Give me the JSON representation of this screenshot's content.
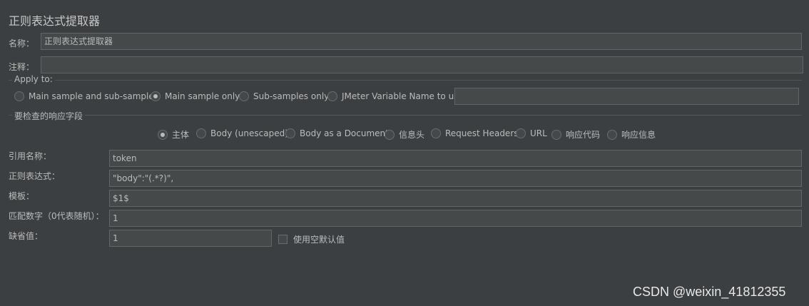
{
  "panel": {
    "title": "正则表达式提取器"
  },
  "name_row": {
    "label": "名称：",
    "value": "正则表达式提取器"
  },
  "comment_row": {
    "label": "注释：",
    "value": ""
  },
  "apply_to": {
    "title": "Apply to:",
    "options": [
      {
        "label": "Main sample and sub-samples",
        "selected": false
      },
      {
        "label": "Main sample only",
        "selected": true
      },
      {
        "label": "Sub-samples only",
        "selected": false
      },
      {
        "label": "JMeter Variable Name to use",
        "selected": false
      }
    ],
    "variable_value": ""
  },
  "response_field": {
    "title": "要检查的响应字段",
    "options": [
      {
        "label": "主体",
        "selected": true
      },
      {
        "label": "Body (unescaped)",
        "selected": false
      },
      {
        "label": "Body as a Document",
        "selected": false
      },
      {
        "label": "信息头",
        "selected": false
      },
      {
        "label": "Request Headers",
        "selected": false
      },
      {
        "label": "URL",
        "selected": false
      },
      {
        "label": "响应代码",
        "selected": false
      },
      {
        "label": "响应信息",
        "selected": false
      }
    ]
  },
  "form": {
    "ref_name": {
      "label": "引用名称：",
      "value": "token"
    },
    "regex": {
      "label": "正则表达式：",
      "value": "\"body\":\"(.*?)\","
    },
    "template": {
      "label": "模板：",
      "value": "$1$"
    },
    "match_no": {
      "label": "匹配数字（0代表随机）：",
      "value": "1"
    },
    "default": {
      "label": "缺省值：",
      "value": "1"
    },
    "use_empty_default": {
      "label": "使用空默认值",
      "checked": false
    }
  },
  "watermark": "CSDN @weixin_41812355"
}
